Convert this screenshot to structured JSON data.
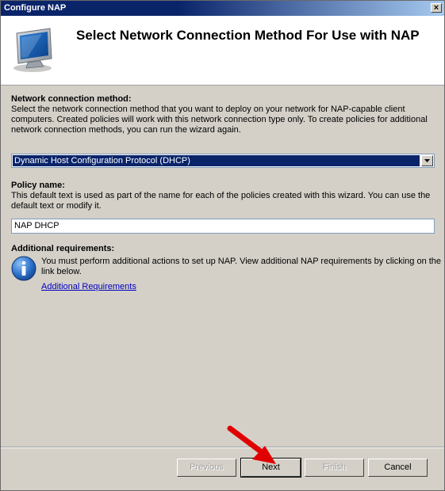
{
  "window": {
    "title": "Configure NAP",
    "close_label": "×"
  },
  "header": {
    "title": "Select Network Connection Method For Use with NAP",
    "icon": "computer-monitor-icon"
  },
  "connection": {
    "label": "Network connection method:",
    "description_lines": [
      "Select the network connection method that you want to deploy on your network for NAP-capable client",
      "computers. Created policies will work with this network connection type only. To create policies for additional",
      "network connection methods, you can run the wizard again."
    ],
    "selected": "Dynamic Host Configuration Protocol (DHCP)"
  },
  "policy": {
    "label": "Policy name:",
    "description_lines": [
      "This default text is used as part of the name for each of the policies created with this wizard. You can use the",
      "default text or modify it."
    ],
    "value": "NAP DHCP"
  },
  "requirements": {
    "label": "Additional requirements:",
    "text_lines": [
      "You must perform additional actions to set up NAP. View additional NAP requirements by clicking on the",
      "link below."
    ],
    "link": "Additional Requirements",
    "icon": "info-icon"
  },
  "buttons": {
    "previous": "Previous",
    "next": "Next",
    "finish": "Finish",
    "cancel": "Cancel"
  },
  "colors": {
    "title_bar": "#0a246a",
    "selection": "#0a246a",
    "link": "#0000c0",
    "annotation_arrow": "#e00000"
  }
}
